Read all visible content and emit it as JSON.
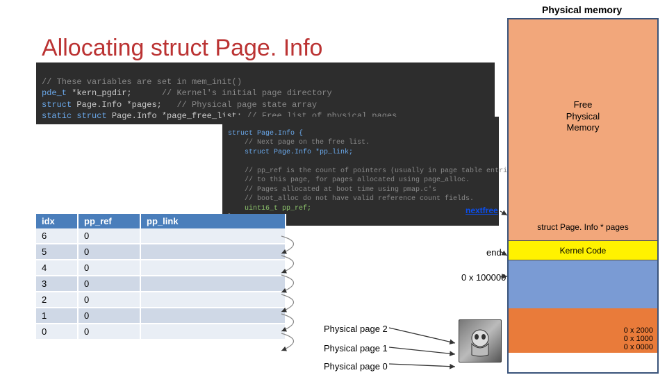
{
  "header": {
    "top_label": "Physical memory",
    "title": "Allocating struct Page. Info"
  },
  "code1": {
    "l1": "// These variables are set in mem_init()",
    "l2a": "pde_t ",
    "l2b": "*kern_pgdir;",
    "l2c": "      // Kernel's initial page directory",
    "l3a": "struct ",
    "l3b": "Page.Info *pages;",
    "l3c": "   // Physical page state array",
    "l4a": "static struct ",
    "l4b": "Page.Info *page_free_list;",
    "l4c": " // Free list of physical pages"
  },
  "code2": {
    "l1": "struct Page.Info {",
    "l2": "    // Next page on the free list.",
    "l3": "    struct Page.Info *pp_link;",
    "l4": "",
    "l5": "    // pp_ref is the count of pointers (usually in page table entries)",
    "l6": "    // to this page, for pages allocated using page_alloc.",
    "l7": "    // Pages allocated at boot time using pmap.c's",
    "l8": "    // boot_alloc do not have valid reference count fields.",
    "l9": "    uint16_t pp_ref;",
    "l10": "};"
  },
  "labels": {
    "nextfree": "nextfree",
    "end": "end",
    "addr_100000": "0 x 100000"
  },
  "mem_diagram": {
    "free_label": "Free\nPhysical\nMemory",
    "pages_label": "struct Page. Info * pages",
    "kernel_label": "Kernel Code",
    "addr_2000": "0 x 2000",
    "addr_1000": "0 x 1000",
    "addr_0000": "0 x 0000"
  },
  "table": {
    "headers": [
      "idx",
      "pp_ref",
      "pp_link"
    ],
    "rows": [
      {
        "idx": "6",
        "pp_ref": "0"
      },
      {
        "idx": "5",
        "pp_ref": "0"
      },
      {
        "idx": "4",
        "pp_ref": "0"
      },
      {
        "idx": "3",
        "pp_ref": "0"
      },
      {
        "idx": "2",
        "pp_ref": "0"
      },
      {
        "idx": "1",
        "pp_ref": "0"
      },
      {
        "idx": "0",
        "pp_ref": "0"
      }
    ]
  },
  "phys_pages": {
    "p2": "Physical page 2",
    "p1": "Physical page 1",
    "p0": "Physical page 0"
  }
}
